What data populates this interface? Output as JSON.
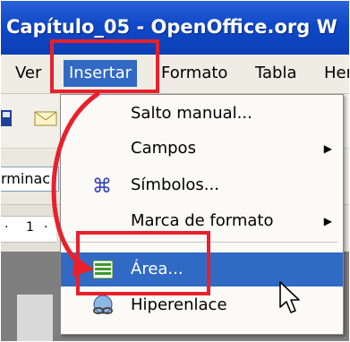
{
  "window": {
    "title": "Capítulo_05 - OpenOffice.org W"
  },
  "menubar": {
    "items": [
      {
        "label": "Ver"
      },
      {
        "label": "Insertar"
      },
      {
        "label": "Formato"
      },
      {
        "label": "Tabla"
      },
      {
        "label": "Her"
      }
    ]
  },
  "toolbar": {
    "style_value": "rminac"
  },
  "ruler": {
    "tick_1": "·",
    "tick_2": "1",
    "tick_3": "·"
  },
  "dropdown": {
    "items": [
      {
        "label": "Salto manual...",
        "submenu": false
      },
      {
        "label": "Campos",
        "submenu": true
      },
      {
        "label": "Símbolos...",
        "submenu": false
      },
      {
        "label": "Marca de formato",
        "submenu": true
      },
      {
        "label": "Área...",
        "submenu": false
      },
      {
        "label": "Hiperenlace",
        "submenu": false
      }
    ],
    "submenu_arrow": "▶"
  },
  "colors": {
    "titlebar": "#1048c8",
    "highlight": "#316ac5",
    "annotation": "#e8202c"
  }
}
